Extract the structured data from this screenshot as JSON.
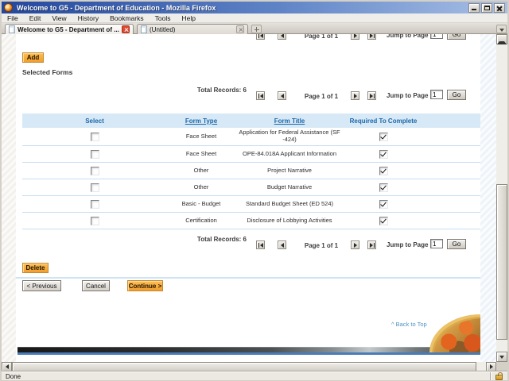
{
  "window": {
    "title": "Welcome to G5 - Department of Education - Mozilla Firefox",
    "status": "Done"
  },
  "menu": {
    "items": [
      "File",
      "Edit",
      "View",
      "History",
      "Bookmarks",
      "Tools",
      "Help"
    ]
  },
  "tabs": {
    "tab1": "Welcome to G5 - Department of ...",
    "tab2": "(Untitled)"
  },
  "page": {
    "add_button": "Add",
    "heading": "Selected Forms",
    "pagination": {
      "total": "Total Records: 6",
      "page": "Page 1 of 1",
      "jump_label": "Jump to Page",
      "jump_value": "1",
      "go": "Go"
    },
    "table": {
      "headers": {
        "select": "Select",
        "type": "Form Type",
        "title": "Form Title",
        "required": "Required To Complete"
      },
      "rows": [
        {
          "type": "Face Sheet",
          "title": "Application for Federal Assistance (SF -424)",
          "selected": false,
          "required": true
        },
        {
          "type": "Face Sheet",
          "title": "OPE-84.018A Applicant Information",
          "selected": false,
          "required": true
        },
        {
          "type": "Other",
          "title": "Project Narrative",
          "selected": false,
          "required": true
        },
        {
          "type": "Other",
          "title": "Budget Narrative",
          "selected": false,
          "required": true
        },
        {
          "type": "Basic - Budget",
          "title": "Standard Budget Sheet (ED 524)",
          "selected": false,
          "required": true
        },
        {
          "type": "Certification",
          "title": "Disclosure of Lobbying Activities",
          "selected": false,
          "required": true
        }
      ]
    },
    "delete_button": "Delete",
    "previous_button": "< Previous",
    "cancel_button": "Cancel",
    "continue_button": "Continue >",
    "back_to_top": "^ Back to Top"
  },
  "colors": {
    "accent_orange": "#f5a234",
    "table_header_bg": "#d7e9f6",
    "table_header_text": "#1b67a9",
    "row_divider": "#c9def0",
    "link_blue": "#4e94c8",
    "titlebar_left": "#23479e",
    "titlebar_right": "#a9c0e6",
    "footer_blue": "#4a7cb8"
  }
}
